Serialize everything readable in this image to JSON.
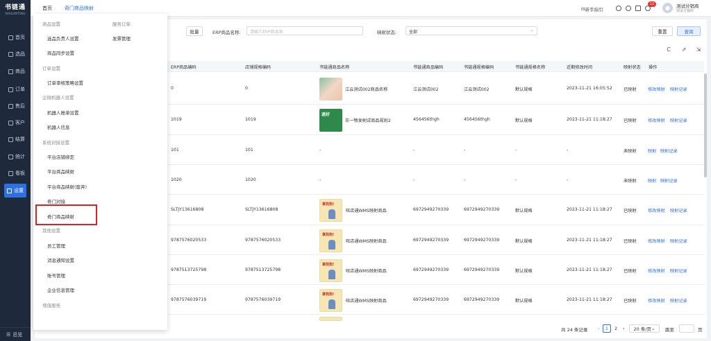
{
  "app": {
    "logo_title": "书链通",
    "logo_subtitle": "SHULIANTONG"
  },
  "sidebar": {
    "items": [
      {
        "label": "首页",
        "icon": "home-icon"
      },
      {
        "label": "选品",
        "icon": "select-icon"
      },
      {
        "label": "商品",
        "icon": "goods-icon"
      },
      {
        "label": "订单",
        "icon": "order-icon"
      },
      {
        "label": "售后",
        "icon": "aftersale-icon"
      },
      {
        "label": "客户",
        "icon": "customer-icon"
      },
      {
        "label": "结算",
        "icon": "settle-icon"
      },
      {
        "label": "统计",
        "icon": "stats-icon"
      },
      {
        "label": "看板",
        "icon": "dashboard-icon"
      },
      {
        "label": "设置",
        "icon": "settings-icon"
      }
    ],
    "active_index": 9,
    "bottom_label": "总览"
  },
  "topbar": {
    "tabs": [
      "首页",
      "奇门商品映射"
    ],
    "active_tab": 1,
    "guide_label": "新手指引",
    "notification_count": "12",
    "user_name": "测试分销商",
    "user_role": "测试分销商"
  },
  "filters": {
    "batch_label": "批量",
    "erp_name_label": "ERP商品名称:",
    "erp_name_placeholder": "请输入ERP商品名",
    "mapping_status_label": "映射状态:",
    "mapping_status_value": "全部",
    "reset_label": "重置",
    "query_label": "查询"
  },
  "toolbar": {
    "icons": [
      "refresh-icon",
      "export-icon",
      "settings-export-icon"
    ],
    "glyphs": [
      "C",
      "⇗",
      "⇲"
    ]
  },
  "table": {
    "columns": [
      "ERP商品编码",
      "店铺规格编码",
      "书链通商品名称",
      "书链通商品编码",
      "书链通规格编码",
      "书链通规格名称",
      "近期修改时间",
      "映射状态",
      "操作"
    ],
    "rows": [
      {
        "erp": "0",
        "shop": "0",
        "name": "江云测试002商品名称",
        "code": "江云测试002",
        "spec_code": "江云测试002",
        "spec_name": "默认规格",
        "time": "2023-11-21 16:05:52",
        "status": "已映射",
        "ops": [
          "修改映射",
          "映射记录"
        ],
        "thumb": "a",
        "thumb_text": ""
      },
      {
        "erp": "1019",
        "shop": "1019",
        "name": "灰一颚发刷试商品规则2",
        "code": "456456thgh",
        "spec_code": "456456thgh",
        "spec_name": "默认规格",
        "time": "2023-11-21 11:18:27",
        "status": "已映射",
        "ops": [
          "修改映射",
          "映射记录"
        ],
        "thumb": "b",
        "thumb_text": "退好"
      },
      {
        "erp": "101",
        "shop": "101",
        "name": "-",
        "code": "-",
        "spec_code": "-",
        "spec_name": "-",
        "time": "-",
        "status": "未映射",
        "ops": [
          "映射",
          "映射记录"
        ],
        "thumb": "",
        "thumb_text": ""
      },
      {
        "erp": "1020",
        "shop": "1020",
        "name": "-",
        "code": "-",
        "spec_code": "-",
        "spec_name": "-",
        "time": "-",
        "status": "未映射",
        "ops": [
          "映射",
          "映射记录"
        ],
        "thumb": "",
        "thumb_text": ""
      },
      {
        "erp": "SLTJY13616808",
        "shop": "SLTJY13616808",
        "name": "旺店通WMS映射商品",
        "code": "6972949270339",
        "spec_code": "6972949270339",
        "spec_name": "默认规格",
        "time": "2023-11-21 11:18:27",
        "status": "已映射",
        "ops": [
          "修改映射",
          "映射记录"
        ],
        "thumb": "c",
        "thumb_text": "掌狗狗!"
      },
      {
        "erp": "9787576020533",
        "shop": "9787576020533",
        "name": "旺店通WMS映射商品",
        "code": "6972949270339",
        "spec_code": "6972949270339",
        "spec_name": "默认规格",
        "time": "2023-11-21 11:18:27",
        "status": "已映射",
        "ops": [
          "修改映射",
          "映射记录"
        ],
        "thumb": "c",
        "thumb_text": "掌狗狗!"
      },
      {
        "erp": "9787513725798",
        "shop": "9787513725798",
        "name": "旺店通WMS映射商品",
        "code": "6972949270339",
        "spec_code": "6972949270339",
        "spec_name": "默认规格",
        "time": "2023-11-21 11:18:27",
        "status": "已映射",
        "ops": [
          "修改映射",
          "映射记录"
        ],
        "thumb": "c",
        "thumb_text": "掌狗狗!"
      },
      {
        "erp": "9787576039719",
        "shop": "9787576039719",
        "name": "旺店通WMS映射商品",
        "code": "6972949270339",
        "spec_code": "6972949270339",
        "spec_name": "默认规格",
        "time": "2023-11-21 11:18:27",
        "status": "已映射",
        "ops": [
          "修改映射",
          "映射记录"
        ],
        "thumb": "c",
        "thumb_text": "掌狗狗!"
      }
    ]
  },
  "pagination": {
    "total": "共 24 条记录",
    "pages": [
      "1",
      "2"
    ],
    "current": "1",
    "page_size": "20 条/页",
    "jump_label": "跳至",
    "page_unit": "页"
  },
  "menu": {
    "col1": [
      {
        "type": "group",
        "label": "商品设置"
      },
      {
        "type": "item",
        "label": "选品负责人设置"
      },
      {
        "type": "item",
        "label": "商品同步设置"
      },
      {
        "type": "group",
        "label": "订单设置"
      },
      {
        "type": "item",
        "label": "订单审核策略设置"
      },
      {
        "type": "group",
        "label": "企微机器人设置"
      },
      {
        "type": "item",
        "label": "机器人推单设置"
      },
      {
        "type": "item",
        "label": "机器人信息"
      },
      {
        "type": "group",
        "label": "系统对接设置"
      },
      {
        "type": "item",
        "label": "平台店铺绑定"
      },
      {
        "type": "item",
        "label": "平台商品映射"
      },
      {
        "type": "item",
        "label": "平台商品映射(废弃)"
      },
      {
        "type": "item",
        "label": "奇门对接"
      },
      {
        "type": "item",
        "label": "奇门商品映射"
      },
      {
        "type": "group",
        "label": "其他设置"
      },
      {
        "type": "item",
        "label": "员工管理"
      },
      {
        "type": "item",
        "label": "消息通知设置"
      },
      {
        "type": "item",
        "label": "账号管理"
      },
      {
        "type": "item",
        "label": "企业信息管理"
      },
      {
        "type": "group",
        "label": "增值服务"
      }
    ],
    "col2": [
      {
        "type": "group",
        "label": "服务订单"
      },
      {
        "type": "item",
        "label": "发票管理"
      }
    ],
    "highlighted_item": "奇门商品映射"
  }
}
